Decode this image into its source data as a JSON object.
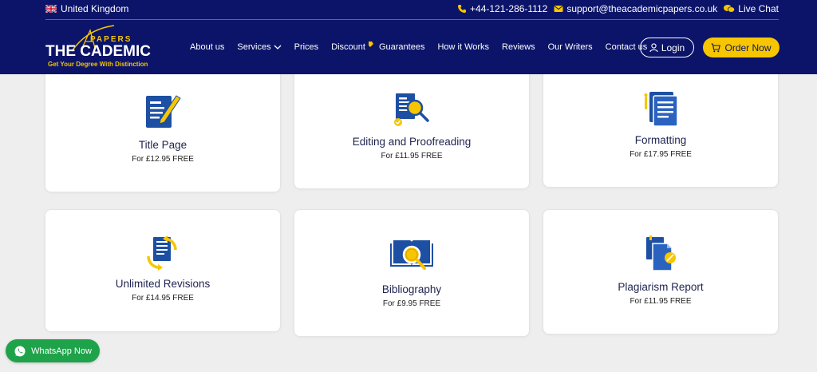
{
  "topbar": {
    "country": "United Kingdom",
    "phone": "+44-121-286-1112",
    "email": "support@theacademicpapers.co.uk",
    "live_chat": "Live Chat"
  },
  "logo": {
    "papers": "PAPERS",
    "main": "THE CADEMIC",
    "tagline": "Get Your Degree With Distinction"
  },
  "nav": {
    "items": [
      "About us",
      "Services",
      "Prices",
      "Discount",
      "Guarantees",
      "How it Works",
      "Reviews",
      "Our Writers",
      "Contact us"
    ]
  },
  "buttons": {
    "login": "Login",
    "order": "Order Now"
  },
  "cards": [
    {
      "title": "Title Page",
      "price": "For £12.95 FREE",
      "icon": "title-page-icon"
    },
    {
      "title": "Editing and Proofreading",
      "price": "For £11.95 FREE",
      "icon": "proofreading-icon"
    },
    {
      "title": "Formatting",
      "price": "For £17.95 FREE",
      "icon": "formatting-icon"
    },
    {
      "title": "Unlimited Revisions",
      "price": "For £14.95 FREE",
      "icon": "revisions-icon"
    },
    {
      "title": "Bibliography",
      "price": "For £9.95 FREE",
      "icon": "bibliography-icon"
    },
    {
      "title": "Plagiarism Report",
      "price": "For £11.95 FREE",
      "icon": "plagiarism-icon"
    }
  ],
  "whatsapp": "WhatsApp Now",
  "colors": {
    "header_bg": "#0b1469",
    "accent_yellow": "#f7c600",
    "icon_blue": "#1d4fa3",
    "whatsapp_green": "#1ea34a",
    "page_bg": "#eeeeee"
  }
}
